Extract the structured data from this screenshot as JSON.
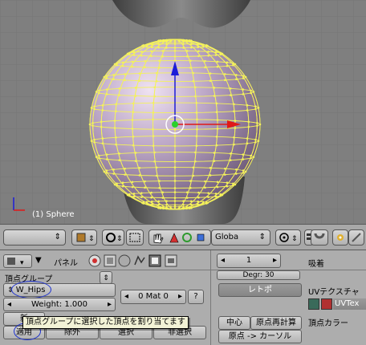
{
  "viewport": {
    "object_label": "(1) Sphere",
    "axis_x": "x",
    "axis_y": "y",
    "colors": {
      "bg": "#7f7f7f",
      "grid": "#757575",
      "wire": "#f4f25a",
      "manip_red": "#e01818",
      "manip_blue": "#1c1cd8",
      "manip_center": "#2bd02b"
    }
  },
  "header": {
    "mode_select": "",
    "pivot_label": "Globa",
    "icons": [
      "view3d-icon",
      "object-mode-icon",
      "pivot-icon",
      "layer-grid-icon",
      "hand-icon",
      "triangle-icon",
      "circle-icon",
      "square-icon",
      "snap-icon"
    ]
  },
  "panel": {
    "panel_label": "パネル",
    "vertex_group_heading": "頂点グループ",
    "group_name": "W_Hips",
    "weight_label": "Weight: 1.000",
    "new_label": "新",
    "assign_label": "適用",
    "remove_label": "除外",
    "select_label": "選択",
    "deselect_label": "非選択",
    "mat_label": "0 Mat 0",
    "question": "?",
    "page_number": "1",
    "degree_label": "Degr: 30",
    "retopo_label": "レトポ",
    "center_label": "中心",
    "origin_recalc_label": "原点再計算",
    "origin_cursor_label": "原点 -> カーソル",
    "snap_heading": "吸着",
    "uv_texture_heading": "UVテクスチャ",
    "uvtex_label": "UVTex",
    "vertex_color_heading": "頂点カラー",
    "tooltip": "頂点グループに選択した頂点を割り当てます"
  }
}
